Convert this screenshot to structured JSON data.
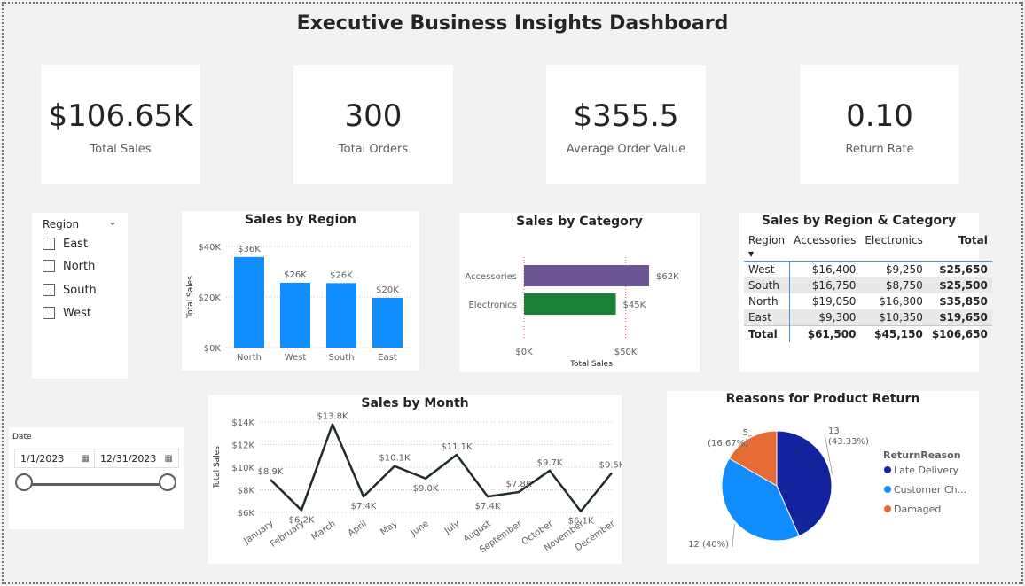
{
  "title": "Executive Business Insights Dashboard",
  "kpis": [
    {
      "value": "$106.65K",
      "label": "Total Sales"
    },
    {
      "value": "300",
      "label": "Total Orders"
    },
    {
      "value": "$355.5",
      "label": "Average Order Value"
    },
    {
      "value": "0.10",
      "label": "Return Rate"
    }
  ],
  "region_slicer": {
    "title": "Region",
    "items": [
      "East",
      "North",
      "South",
      "West"
    ]
  },
  "date_slicer": {
    "title": "Date",
    "start": "1/1/2023",
    "end": "12/31/2023"
  },
  "matrix": {
    "title": "Sales by Region & Category",
    "columns": [
      "Region",
      "Accessories",
      "Electronics",
      "Total"
    ],
    "rows": [
      [
        "West",
        "$16,400",
        "$9,250",
        "$25,650"
      ],
      [
        "South",
        "$16,750",
        "$8,750",
        "$25,500"
      ],
      [
        "North",
        "$19,050",
        "$16,800",
        "$35,850"
      ],
      [
        "East",
        "$9,300",
        "$10,350",
        "$19,650"
      ]
    ],
    "total_row": [
      "Total",
      "$61,500",
      "$45,150",
      "$106,650"
    ]
  },
  "colors": {
    "bar_blue": "#118dff",
    "accessories": "#6b5594",
    "electronics": "#1a8035",
    "line": "#1f2d26",
    "pie_dark": "#12239e",
    "pie_blue": "#118dff",
    "pie_orange": "#e66c37"
  },
  "chart_data": [
    {
      "id": "region",
      "type": "bar",
      "title": "Sales by Region",
      "xlabel": "",
      "ylabel": "Total Sales",
      "categories": [
        "North",
        "West",
        "South",
        "East"
      ],
      "values": [
        35850,
        25650,
        25500,
        19650
      ],
      "data_labels": [
        "$36K",
        "$26K",
        "$26K",
        "$20K"
      ],
      "yticks": [
        "$0K",
        "$20K",
        "$40K"
      ],
      "ylim": [
        0,
        40000
      ],
      "grid": true
    },
    {
      "id": "category",
      "type": "bar",
      "orientation": "horizontal",
      "title": "Sales by Category",
      "xlabel": "Total Sales",
      "ylabel": "",
      "categories": [
        "Accessories",
        "Electronics"
      ],
      "values": [
        61500,
        45150
      ],
      "data_labels": [
        "$62K",
        "$45K"
      ],
      "xticks": [
        "$0K",
        "$50K"
      ],
      "xlim": [
        0,
        75000
      ],
      "grid": true
    },
    {
      "id": "month",
      "type": "line",
      "title": "Sales by Month",
      "xlabel": "",
      "ylabel": "Total Sales",
      "categories": [
        "January",
        "February",
        "March",
        "April",
        "May",
        "June",
        "July",
        "August",
        "September",
        "October",
        "November",
        "December"
      ],
      "values": [
        8900,
        6200,
        13800,
        7400,
        10100,
        9000,
        11100,
        7400,
        7800,
        9700,
        6100,
        9500
      ],
      "data_labels": [
        "$8.9K",
        "$6.2K",
        "$13.8K",
        "$7.4K",
        "$10.1K",
        "$9.0K",
        "$11.1K",
        "$7.4K",
        "$7.8K",
        "$9.7K",
        "$6.1K",
        "$9.5K"
      ],
      "yticks": [
        "$6K",
        "$8K",
        "$10K",
        "$12K",
        "$14K"
      ],
      "ylim": [
        6000,
        14000
      ],
      "grid": true
    },
    {
      "id": "returns",
      "type": "pie",
      "title": "Reasons for Product Return",
      "legend_title": "ReturnReason",
      "legend_position": "right",
      "slices": [
        {
          "name": "Late Delivery",
          "legend_label": "Late Delivery",
          "value": 13,
          "label": "13",
          "pct": "(43.33%)"
        },
        {
          "name": "Customer Change of Mind",
          "legend_label": "Customer Ch...",
          "value": 12,
          "label": "12 (40%)",
          "pct": ""
        },
        {
          "name": "Damaged",
          "legend_label": "Damaged",
          "value": 5,
          "label": "5",
          "pct": "(16.67%)"
        }
      ]
    }
  ]
}
